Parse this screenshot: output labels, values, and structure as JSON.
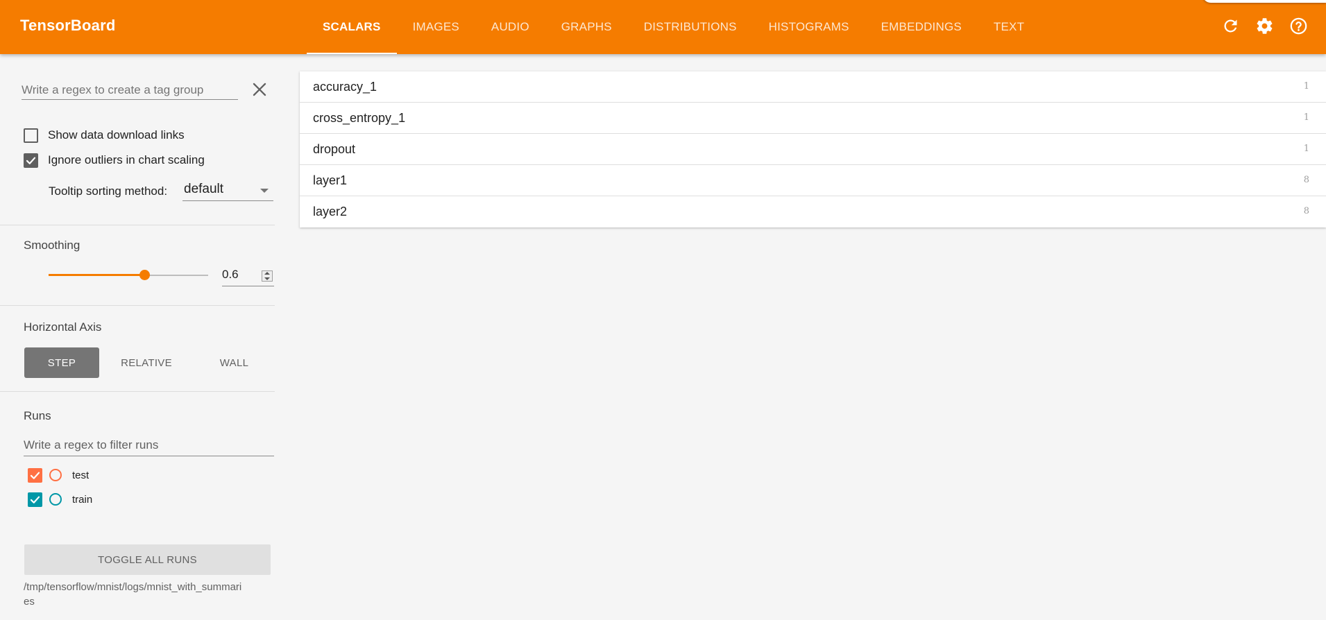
{
  "header": {
    "title": "TensorBoard",
    "tabs": [
      {
        "label": "SCALARS",
        "active": true
      },
      {
        "label": "IMAGES",
        "active": false
      },
      {
        "label": "AUDIO",
        "active": false
      },
      {
        "label": "GRAPHS",
        "active": false
      },
      {
        "label": "DISTRIBUTIONS",
        "active": false
      },
      {
        "label": "HISTOGRAMS",
        "active": false
      },
      {
        "label": "EMBEDDINGS",
        "active": false
      },
      {
        "label": "TEXT",
        "active": false
      }
    ],
    "icons": [
      "refresh-icon",
      "settings-icon",
      "help-icon"
    ]
  },
  "sidebar": {
    "tag_filter": {
      "placeholder": "Write a regex to create a tag group",
      "value": ""
    },
    "show_download_links": {
      "label": "Show data download links",
      "checked": false
    },
    "ignore_outliers": {
      "label": "Ignore outliers in chart scaling",
      "checked": true
    },
    "tooltip_sorting": {
      "label": "Tooltip sorting method:",
      "value": "default"
    },
    "smoothing": {
      "title": "Smoothing",
      "value": "0.6",
      "fraction": 0.6
    },
    "horizontal_axis": {
      "title": "Horizontal Axis",
      "options": [
        {
          "label": "STEP",
          "active": true
        },
        {
          "label": "RELATIVE",
          "active": false
        },
        {
          "label": "WALL",
          "active": false
        }
      ]
    },
    "runs": {
      "title": "Runs",
      "filter_placeholder": "Write a regex to filter runs",
      "items": [
        {
          "label": "test",
          "checked": true,
          "color": "#ff7043"
        },
        {
          "label": "train",
          "checked": true,
          "color": "#0097a7"
        }
      ],
      "toggle_all_label": "TOGGLE ALL RUNS",
      "logdir": "/tmp/tensorflow/mnist/logs/mnist_with_summaries"
    }
  },
  "main": {
    "tag_groups": [
      {
        "name": "accuracy_1",
        "count": "1"
      },
      {
        "name": "cross_entropy_1",
        "count": "1"
      },
      {
        "name": "dropout",
        "count": "1"
      },
      {
        "name": "layer1",
        "count": "8"
      },
      {
        "name": "layer2",
        "count": "8"
      }
    ]
  },
  "colors": {
    "accent": "#f57c00",
    "active_axis_button": "#757575"
  }
}
